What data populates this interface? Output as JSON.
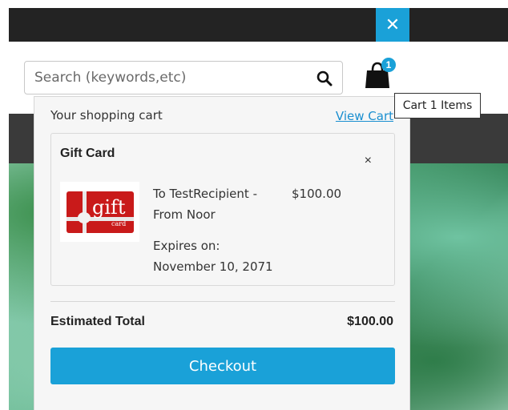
{
  "header": {
    "close_symbol": "✕"
  },
  "search": {
    "placeholder": "Search (keywords,etc)",
    "value": ""
  },
  "cart": {
    "count": "1",
    "tooltip": "Cart 1 Items"
  },
  "dropdown": {
    "title": "Your shopping cart",
    "view_cart_label": "View Cart",
    "items": [
      {
        "name": "Gift Card",
        "remove_symbol": "×",
        "image_text_main": "gift",
        "image_text_sub": "card",
        "description": "To TestRecipient - From Noor",
        "price": "$100.00",
        "expires_label": "Expires on:",
        "expires_date": "November 10, 2071"
      }
    ],
    "total_label": "Estimated Total",
    "total_value": "$100.00",
    "checkout_label": "Checkout"
  },
  "colors": {
    "accent": "#1aa1d8",
    "topbar": "#232323",
    "link": "#1a8fd0",
    "gift_red": "#c91a1a"
  }
}
